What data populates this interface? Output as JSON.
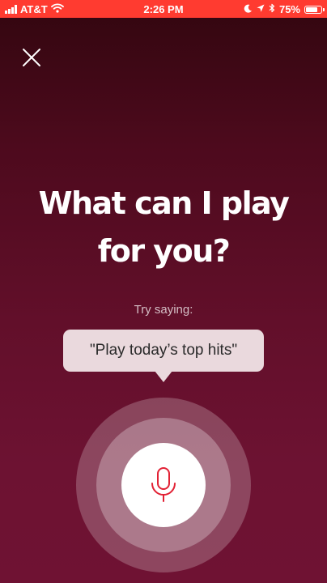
{
  "status_bar": {
    "carrier": "AT&T",
    "time": "2:26 PM",
    "battery_percent": "75%",
    "battery_level": 0.75,
    "background_color": "#ff3b30",
    "icons": [
      "signal-icon",
      "wifi-icon",
      "moon-icon",
      "location-icon",
      "bluetooth-icon",
      "battery-icon"
    ]
  },
  "close_icon": "close-icon",
  "headline": {
    "line1": "What can I play",
    "line2": "for you?"
  },
  "hint": {
    "label": "Try saying:",
    "suggestion": "\"Play today’s top hits\""
  },
  "mic": {
    "icon": "microphone-icon",
    "icon_color": "#e22134"
  }
}
